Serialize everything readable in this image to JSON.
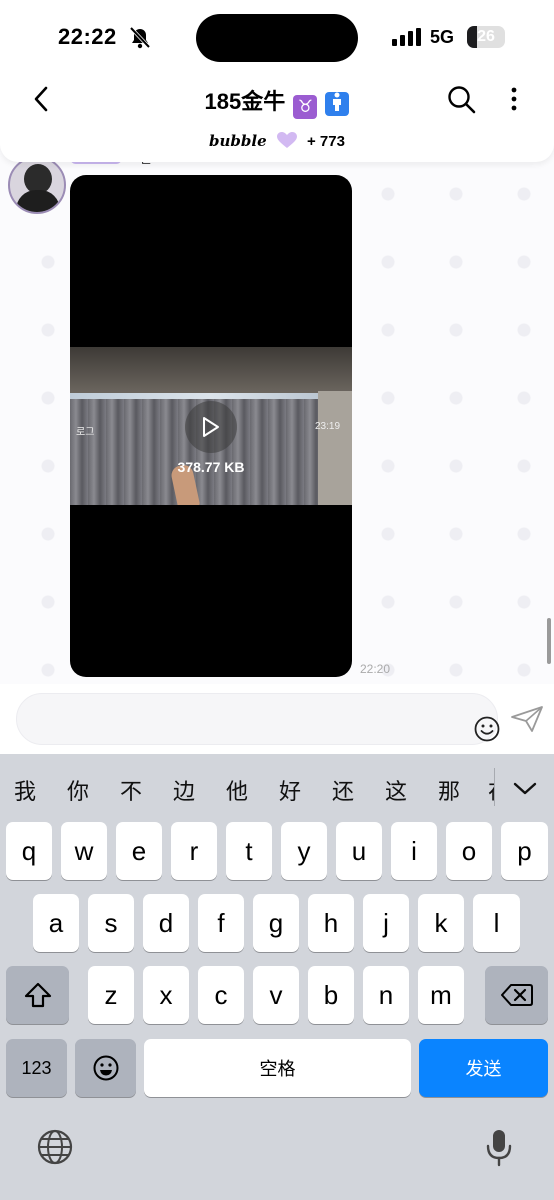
{
  "status": {
    "time": "22:22",
    "network": "5G",
    "battery": "26",
    "battery_level": 0.26
  },
  "header": {
    "title": "185金牛",
    "title_emojis": [
      "♉",
      "🚹"
    ],
    "subtitle_brand": "bubble",
    "subtitle_count": "+ 773"
  },
  "chat": {
    "sender_name_fragment": "ㅋ근ㅇ",
    "video": {
      "file_size": "378.77 KB",
      "overlay_left": "로그",
      "overlay_right": "23:19"
    },
    "message_time": "22:20"
  },
  "composer": {
    "placeholder": ""
  },
  "keyboard": {
    "candidates": [
      "我",
      "你",
      "不",
      "边",
      "他",
      "好",
      "还",
      "这",
      "那",
      "在"
    ],
    "rows": [
      [
        "q",
        "w",
        "e",
        "r",
        "t",
        "y",
        "u",
        "i",
        "o",
        "p"
      ],
      [
        "a",
        "s",
        "d",
        "f",
        "g",
        "h",
        "j",
        "k",
        "l"
      ],
      [
        "z",
        "x",
        "c",
        "v",
        "b",
        "n",
        "m"
      ]
    ],
    "numbers_label": "123",
    "space_label": "空格",
    "send_label": "发送"
  },
  "colors": {
    "accent_blue": "#0a84ff",
    "bubble_purple": "#c9b7f0",
    "keyboard_bg": "#d2d5db"
  }
}
